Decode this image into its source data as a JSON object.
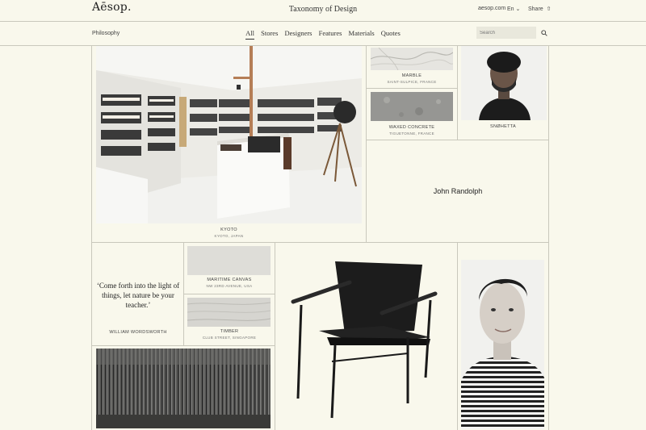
{
  "header": {
    "logo": "Aēsop.",
    "title": "Taxonomy of Design",
    "site_link": "aesop.com",
    "language": "En",
    "share": "Share"
  },
  "nav": {
    "section": "Philosophy",
    "tabs": [
      "All",
      "Stores",
      "Designers",
      "Features",
      "Materials",
      "Quotes"
    ],
    "active_tab": "All",
    "search_placeholder": "Search"
  },
  "tiles": {
    "kyoto": {
      "title": "KYOTO",
      "subtitle": "KYOTO, JAPAN"
    },
    "marble": {
      "title": "MARBLE",
      "subtitle": "SAINT-SULPICE, FRANCE"
    },
    "waxed_concrete": {
      "title": "WAXED CONCRETE",
      "subtitle": "TIGUETONNE, FRANCE"
    },
    "snohetta": {
      "title": "SNØHETTA"
    },
    "john_randolph": {
      "name": "John Randolph"
    },
    "quote": {
      "text": "‘Come forth into the light of things, let nature be your teacher.’",
      "author": "WILLIAM WORDSWORTH"
    },
    "maritime_canvas": {
      "title": "MARITIME CANVAS",
      "subtitle": "NW 23RD AVENUE, USA"
    },
    "timber": {
      "title": "TIMBER",
      "subtitle": "CLUB STREET, SINGAPORE"
    }
  },
  "colors": {
    "background": "#f9f8ec",
    "grid_line": "#c9c8bc",
    "text": "#333333"
  }
}
